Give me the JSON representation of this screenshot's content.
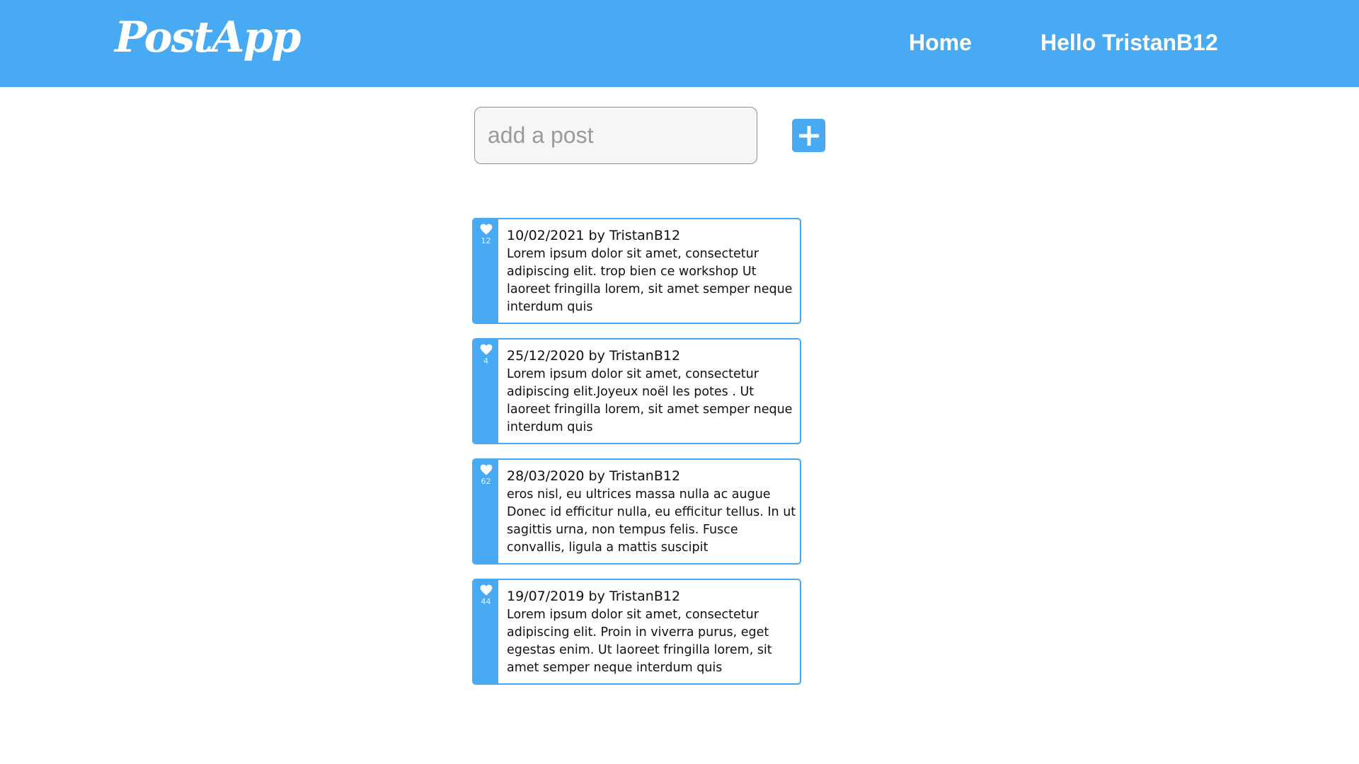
{
  "navbar": {
    "logo": "PostApp",
    "home_label": "Home",
    "greeting": "Hello TristanB12",
    "background_color": "#47aaf2"
  },
  "composer": {
    "placeholder": "add a post",
    "add_icon": "plus-icon"
  },
  "posts": [
    {
      "likes": "12",
      "header": "10/02/2021 by TristanB12",
      "text": "Lorem ipsum dolor sit amet, consectetur adipiscing elit. trop bien ce workshop Ut laoreet fringilla lorem, sit amet semper neque interdum quis"
    },
    {
      "likes": "4",
      "header": "25/12/2020 by TristanB12",
      "text": "Lorem ipsum dolor sit amet, consectetur adipiscing elit.Joyeux noël les potes . Ut laoreet fringilla lorem, sit amet semper neque interdum quis"
    },
    {
      "likes": "62",
      "header": "28/03/2020 by TristanB12",
      "text": "eros nisl, eu ultrices massa nulla ac augue Donec id efficitur nulla, eu efficitur tellus. In ut sagittis urna, non tempus felis. Fusce convallis, ligula a mattis suscipit"
    },
    {
      "likes": "44",
      "header": "19/07/2019 by TristanB12",
      "text": "Lorem ipsum dolor sit amet, consectetur adipiscing elit. Proin in viverra purus, eget egestas enim. Ut laoreet fringilla lorem, sit amet semper neque interdum quis"
    }
  ]
}
